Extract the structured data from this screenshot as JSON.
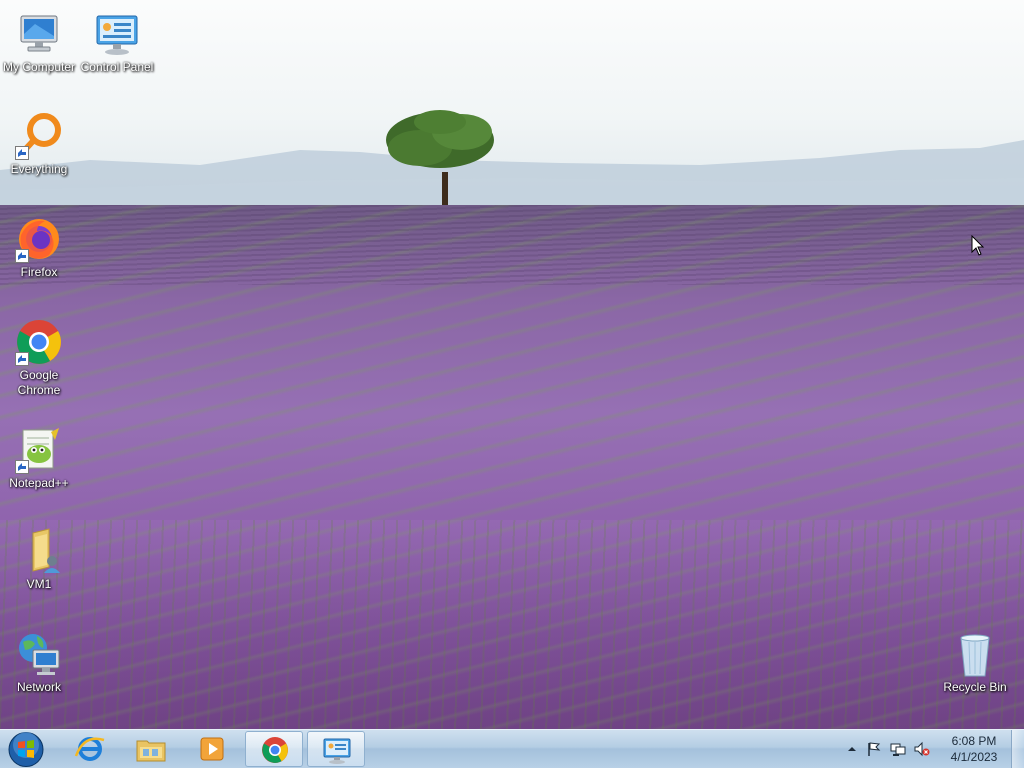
{
  "desktop": {
    "icons": [
      {
        "label": "My Computer"
      },
      {
        "label": "Control Panel"
      },
      {
        "label": "Everything"
      },
      {
        "label": "Firefox"
      },
      {
        "label": "Google Chrome"
      },
      {
        "label": "Notepad++"
      },
      {
        "label": "VM1"
      },
      {
        "label": "Network"
      },
      {
        "label": "Recycle Bin"
      }
    ]
  },
  "taskbar": {
    "pinned": [
      {
        "name": "internet-explorer"
      },
      {
        "name": "file-explorer"
      },
      {
        "name": "media-player"
      },
      {
        "name": "google-chrome"
      },
      {
        "name": "control-panel"
      }
    ],
    "clock": {
      "time": "6:08 PM",
      "date": "4/1/2023"
    }
  },
  "colors": {
    "taskbar": "#b4cde3",
    "lavender": "#8f63ad",
    "sky": "#f1f5f6"
  }
}
